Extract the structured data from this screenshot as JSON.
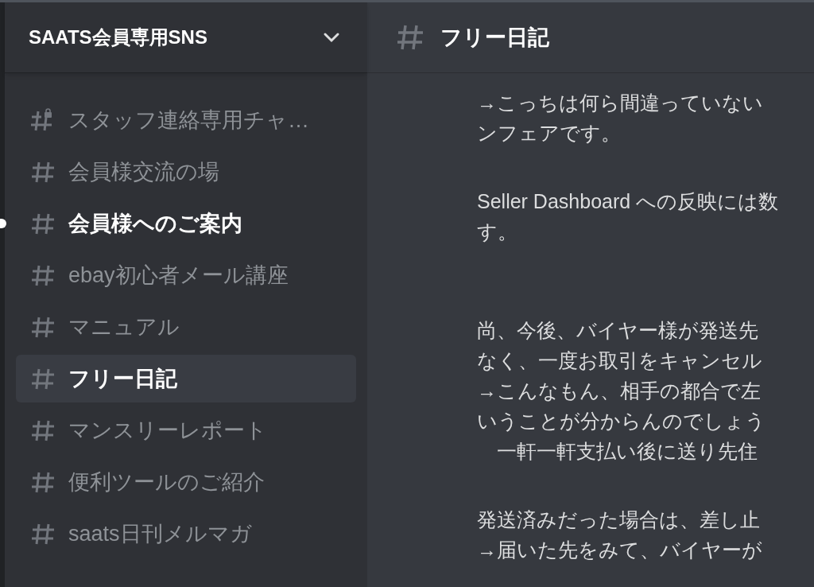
{
  "server": {
    "name": "SAATS会員専用SNS"
  },
  "channels": [
    {
      "name": "スタッフ連絡専用チャ…",
      "kind": "locked",
      "unread": false,
      "selected": false
    },
    {
      "name": "会員様交流の場",
      "kind": "text",
      "unread": false,
      "selected": false
    },
    {
      "name": "会員様へのご案内",
      "kind": "text",
      "unread": true,
      "selected": false
    },
    {
      "name": "ebay初心者メール講座",
      "kind": "text",
      "unread": false,
      "selected": false
    },
    {
      "name": "マニュアル",
      "kind": "text",
      "unread": false,
      "selected": false
    },
    {
      "name": "フリー日記",
      "kind": "text",
      "unread": false,
      "selected": true
    },
    {
      "name": "マンスリーレポート",
      "kind": "text",
      "unread": false,
      "selected": false
    },
    {
      "name": "便利ツールのご紹介",
      "kind": "text",
      "unread": false,
      "selected": false
    },
    {
      "name": "saats日刊メルマガ",
      "kind": "text",
      "unread": false,
      "selected": false
    }
  ],
  "header": {
    "channel": "フリー日記"
  },
  "message_paragraphs": [
    {
      "lines": [
        "→こっちは何ら間違っていない",
        "ンフェアです。"
      ]
    },
    {
      "lines": [
        "Seller Dashboard への反映には数",
        "す。"
      ]
    },
    {
      "lines": [
        "尚、今後、バイヤー様が発送先",
        "なく、一度お取引をキャンセル",
        "→こんなもん、相手の都合で左",
        "いうことが分からんのでしょう",
        "　一軒一軒支払い後に送り先住"
      ]
    },
    {
      "lines": [
        "発送済みだった場合は、差し止",
        "→届いた先をみて、バイヤーが"
      ]
    }
  ]
}
